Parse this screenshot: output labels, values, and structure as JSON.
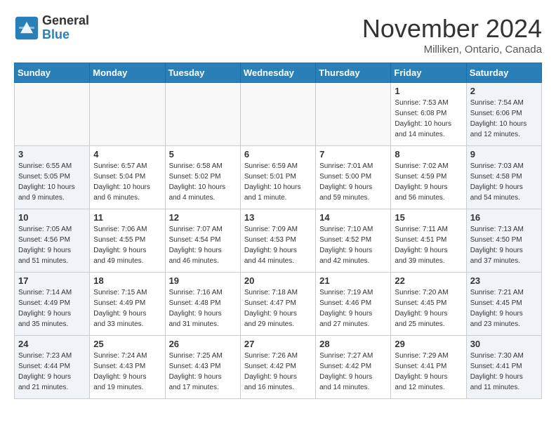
{
  "header": {
    "logo_line1": "General",
    "logo_line2": "Blue",
    "month": "November 2024",
    "location": "Milliken, Ontario, Canada"
  },
  "weekdays": [
    "Sunday",
    "Monday",
    "Tuesday",
    "Wednesday",
    "Thursday",
    "Friday",
    "Saturday"
  ],
  "weeks": [
    [
      {
        "day": "",
        "info": "",
        "empty": true
      },
      {
        "day": "",
        "info": "",
        "empty": true
      },
      {
        "day": "",
        "info": "",
        "empty": true
      },
      {
        "day": "",
        "info": "",
        "empty": true
      },
      {
        "day": "",
        "info": "",
        "empty": true
      },
      {
        "day": "1",
        "info": "Sunrise: 7:53 AM\nSunset: 6:08 PM\nDaylight: 10 hours\nand 14 minutes."
      },
      {
        "day": "2",
        "info": "Sunrise: 7:54 AM\nSunset: 6:06 PM\nDaylight: 10 hours\nand 12 minutes.",
        "saturday": true
      }
    ],
    [
      {
        "day": "3",
        "info": "Sunrise: 6:55 AM\nSunset: 5:05 PM\nDaylight: 10 hours\nand 9 minutes.",
        "sunday": true
      },
      {
        "day": "4",
        "info": "Sunrise: 6:57 AM\nSunset: 5:04 PM\nDaylight: 10 hours\nand 6 minutes."
      },
      {
        "day": "5",
        "info": "Sunrise: 6:58 AM\nSunset: 5:02 PM\nDaylight: 10 hours\nand 4 minutes."
      },
      {
        "day": "6",
        "info": "Sunrise: 6:59 AM\nSunset: 5:01 PM\nDaylight: 10 hours\nand 1 minute."
      },
      {
        "day": "7",
        "info": "Sunrise: 7:01 AM\nSunset: 5:00 PM\nDaylight: 9 hours\nand 59 minutes."
      },
      {
        "day": "8",
        "info": "Sunrise: 7:02 AM\nSunset: 4:59 PM\nDaylight: 9 hours\nand 56 minutes."
      },
      {
        "day": "9",
        "info": "Sunrise: 7:03 AM\nSunset: 4:58 PM\nDaylight: 9 hours\nand 54 minutes.",
        "saturday": true
      }
    ],
    [
      {
        "day": "10",
        "info": "Sunrise: 7:05 AM\nSunset: 4:56 PM\nDaylight: 9 hours\nand 51 minutes.",
        "sunday": true
      },
      {
        "day": "11",
        "info": "Sunrise: 7:06 AM\nSunset: 4:55 PM\nDaylight: 9 hours\nand 49 minutes."
      },
      {
        "day": "12",
        "info": "Sunrise: 7:07 AM\nSunset: 4:54 PM\nDaylight: 9 hours\nand 46 minutes."
      },
      {
        "day": "13",
        "info": "Sunrise: 7:09 AM\nSunset: 4:53 PM\nDaylight: 9 hours\nand 44 minutes."
      },
      {
        "day": "14",
        "info": "Sunrise: 7:10 AM\nSunset: 4:52 PM\nDaylight: 9 hours\nand 42 minutes."
      },
      {
        "day": "15",
        "info": "Sunrise: 7:11 AM\nSunset: 4:51 PM\nDaylight: 9 hours\nand 39 minutes."
      },
      {
        "day": "16",
        "info": "Sunrise: 7:13 AM\nSunset: 4:50 PM\nDaylight: 9 hours\nand 37 minutes.",
        "saturday": true
      }
    ],
    [
      {
        "day": "17",
        "info": "Sunrise: 7:14 AM\nSunset: 4:49 PM\nDaylight: 9 hours\nand 35 minutes.",
        "sunday": true
      },
      {
        "day": "18",
        "info": "Sunrise: 7:15 AM\nSunset: 4:49 PM\nDaylight: 9 hours\nand 33 minutes."
      },
      {
        "day": "19",
        "info": "Sunrise: 7:16 AM\nSunset: 4:48 PM\nDaylight: 9 hours\nand 31 minutes."
      },
      {
        "day": "20",
        "info": "Sunrise: 7:18 AM\nSunset: 4:47 PM\nDaylight: 9 hours\nand 29 minutes."
      },
      {
        "day": "21",
        "info": "Sunrise: 7:19 AM\nSunset: 4:46 PM\nDaylight: 9 hours\nand 27 minutes."
      },
      {
        "day": "22",
        "info": "Sunrise: 7:20 AM\nSunset: 4:45 PM\nDaylight: 9 hours\nand 25 minutes."
      },
      {
        "day": "23",
        "info": "Sunrise: 7:21 AM\nSunset: 4:45 PM\nDaylight: 9 hours\nand 23 minutes.",
        "saturday": true
      }
    ],
    [
      {
        "day": "24",
        "info": "Sunrise: 7:23 AM\nSunset: 4:44 PM\nDaylight: 9 hours\nand 21 minutes.",
        "sunday": true
      },
      {
        "day": "25",
        "info": "Sunrise: 7:24 AM\nSunset: 4:43 PM\nDaylight: 9 hours\nand 19 minutes."
      },
      {
        "day": "26",
        "info": "Sunrise: 7:25 AM\nSunset: 4:43 PM\nDaylight: 9 hours\nand 17 minutes."
      },
      {
        "day": "27",
        "info": "Sunrise: 7:26 AM\nSunset: 4:42 PM\nDaylight: 9 hours\nand 16 minutes."
      },
      {
        "day": "28",
        "info": "Sunrise: 7:27 AM\nSunset: 4:42 PM\nDaylight: 9 hours\nand 14 minutes."
      },
      {
        "day": "29",
        "info": "Sunrise: 7:29 AM\nSunset: 4:41 PM\nDaylight: 9 hours\nand 12 minutes."
      },
      {
        "day": "30",
        "info": "Sunrise: 7:30 AM\nSunset: 4:41 PM\nDaylight: 9 hours\nand 11 minutes.",
        "saturday": true
      }
    ]
  ]
}
